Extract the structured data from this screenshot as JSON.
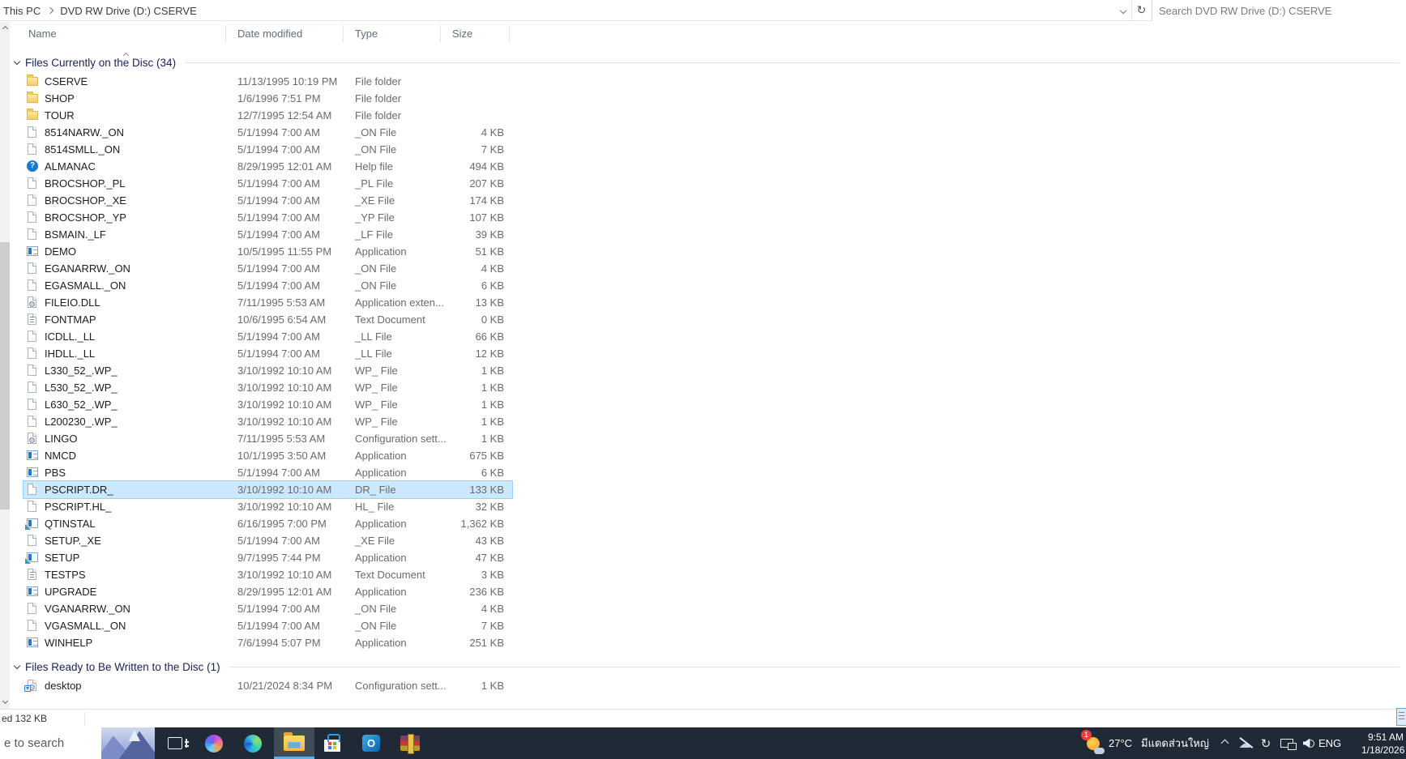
{
  "address_bar": {
    "breadcrumb": [
      "This PC",
      "DVD RW Drive (D:) CSERVE"
    ],
    "search_placeholder": "Search DVD RW Drive (D:) CSERVE",
    "refresh_glyph": "↻"
  },
  "columns": {
    "name": "Name",
    "date": "Date modified",
    "type": "Type",
    "size": "Size"
  },
  "groups": [
    {
      "label": "Files Currently on the Disc (34)",
      "files": [
        {
          "name": "CSERVE",
          "date": "11/13/1995 10:19 PM",
          "type": "File folder",
          "size": "",
          "icon": "folder"
        },
        {
          "name": "SHOP",
          "date": "1/6/1996 7:51 PM",
          "type": "File folder",
          "size": "",
          "icon": "folder"
        },
        {
          "name": "TOUR",
          "date": "12/7/1995 12:54 AM",
          "type": "File folder",
          "size": "",
          "icon": "folder"
        },
        {
          "name": "8514NARW._ON",
          "date": "5/1/1994 7:00 AM",
          "type": "_ON File",
          "size": "4 KB",
          "icon": "file"
        },
        {
          "name": "8514SMLL._ON",
          "date": "5/1/1994 7:00 AM",
          "type": "_ON File",
          "size": "7 KB",
          "icon": "file"
        },
        {
          "name": "ALMANAC",
          "date": "8/29/1995 12:01 AM",
          "type": "Help file",
          "size": "494 KB",
          "icon": "help"
        },
        {
          "name": "BROCSHOP._PL",
          "date": "5/1/1994 7:00 AM",
          "type": "_PL File",
          "size": "207 KB",
          "icon": "file"
        },
        {
          "name": "BROCSHOP._XE",
          "date": "5/1/1994 7:00 AM",
          "type": "_XE File",
          "size": "174 KB",
          "icon": "file"
        },
        {
          "name": "BROCSHOP._YP",
          "date": "5/1/1994 7:00 AM",
          "type": "_YP File",
          "size": "107 KB",
          "icon": "file"
        },
        {
          "name": "BSMAIN._LF",
          "date": "5/1/1994 7:00 AM",
          "type": "_LF File",
          "size": "39 KB",
          "icon": "file"
        },
        {
          "name": "DEMO",
          "date": "10/5/1995 11:55 PM",
          "type": "Application",
          "size": "51 KB",
          "icon": "app"
        },
        {
          "name": "EGANARRW._ON",
          "date": "5/1/1994 7:00 AM",
          "type": "_ON File",
          "size": "4 KB",
          "icon": "file"
        },
        {
          "name": "EGASMALL._ON",
          "date": "5/1/1994 7:00 AM",
          "type": "_ON File",
          "size": "6 KB",
          "icon": "file"
        },
        {
          "name": "FILEIO.DLL",
          "date": "7/11/1995 5:53 AM",
          "type": "Application exten...",
          "size": "13 KB",
          "icon": "dll"
        },
        {
          "name": "FONTMAP",
          "date": "10/6/1995 6:54 AM",
          "type": "Text Document",
          "size": "0 KB",
          "icon": "text"
        },
        {
          "name": "ICDLL._LL",
          "date": "5/1/1994 7:00 AM",
          "type": "_LL File",
          "size": "66 KB",
          "icon": "file"
        },
        {
          "name": "IHDLL._LL",
          "date": "5/1/1994 7:00 AM",
          "type": "_LL File",
          "size": "12 KB",
          "icon": "file"
        },
        {
          "name": "L330_52_.WP_",
          "date": "3/10/1992 10:10 AM",
          "type": "WP_ File",
          "size": "1 KB",
          "icon": "file"
        },
        {
          "name": "L530_52_.WP_",
          "date": "3/10/1992 10:10 AM",
          "type": "WP_ File",
          "size": "1 KB",
          "icon": "file"
        },
        {
          "name": "L630_52_.WP_",
          "date": "3/10/1992 10:10 AM",
          "type": "WP_ File",
          "size": "1 KB",
          "icon": "file"
        },
        {
          "name": "L200230_.WP_",
          "date": "3/10/1992 10:10 AM",
          "type": "WP_ File",
          "size": "1 KB",
          "icon": "file"
        },
        {
          "name": "LINGO",
          "date": "7/11/1995 5:53 AM",
          "type": "Configuration sett...",
          "size": "1 KB",
          "icon": "config"
        },
        {
          "name": "NMCD",
          "date": "10/1/1995 3:50 AM",
          "type": "Application",
          "size": "675 KB",
          "icon": "app"
        },
        {
          "name": "PBS",
          "date": "5/1/1994 7:00 AM",
          "type": "Application",
          "size": "6 KB",
          "icon": "app"
        },
        {
          "name": "PSCRIPT.DR_",
          "date": "3/10/1992 10:10 AM",
          "type": "DR_ File",
          "size": "133 KB",
          "icon": "file",
          "selected": true
        },
        {
          "name": "PSCRIPT.HL_",
          "date": "3/10/1992 10:10 AM",
          "type": "HL_ File",
          "size": "32 KB",
          "icon": "file"
        },
        {
          "name": "QTINSTAL",
          "date": "6/16/1995 7:00 PM",
          "type": "Application",
          "size": "1,362 KB",
          "icon": "app-install"
        },
        {
          "name": "SETUP._XE",
          "date": "5/1/1994 7:00 AM",
          "type": "_XE File",
          "size": "43 KB",
          "icon": "file"
        },
        {
          "name": "SETUP",
          "date": "9/7/1995 7:44 PM",
          "type": "Application",
          "size": "47 KB",
          "icon": "app-install"
        },
        {
          "name": "TESTPS",
          "date": "3/10/1992 10:10 AM",
          "type": "Text Document",
          "size": "3 KB",
          "icon": "text"
        },
        {
          "name": "UPGRADE",
          "date": "8/29/1995 12:01 AM",
          "type": "Application",
          "size": "236 KB",
          "icon": "app"
        },
        {
          "name": "VGANARRW._ON",
          "date": "5/1/1994 7:00 AM",
          "type": "_ON File",
          "size": "4 KB",
          "icon": "file"
        },
        {
          "name": "VGASMALL._ON",
          "date": "5/1/1994 7:00 AM",
          "type": "_ON File",
          "size": "7 KB",
          "icon": "file"
        },
        {
          "name": "WINHELP",
          "date": "7/6/1994 5:07 PM",
          "type": "Application",
          "size": "251 KB",
          "icon": "app"
        }
      ]
    },
    {
      "label": "Files Ready to Be Written to the Disc (1)",
      "files": [
        {
          "name": "desktop",
          "date": "10/21/2024 8:34 PM",
          "type": "Configuration sett...",
          "size": "1 KB",
          "icon": "config-write"
        }
      ]
    }
  ],
  "status_bar": {
    "text": "ed  132 KB"
  },
  "taskbar": {
    "search_text": "e to search",
    "icons": [
      "task-view",
      "copilot",
      "edge",
      "file-explorer",
      "store",
      "outlook",
      "winrar"
    ],
    "active_icon": "file-explorer",
    "tray": {
      "weather_badge": "1",
      "temperature": "27°C",
      "weather_text": "มีแดดส่วนใหญ่",
      "language": "ENG",
      "time": "9:51 AM",
      "date": "1/18/2026",
      "help_glyph": "?"
    }
  },
  "colors": {
    "selection_fill": "#cce8ff",
    "selection_border": "#99d1ff",
    "group_header_text": "#18215b",
    "taskbar_bg": "#202a36",
    "active_underline": "#5fb2e8",
    "folder_yellow": "#f4cd64",
    "badge_red": "#e8413c"
  }
}
